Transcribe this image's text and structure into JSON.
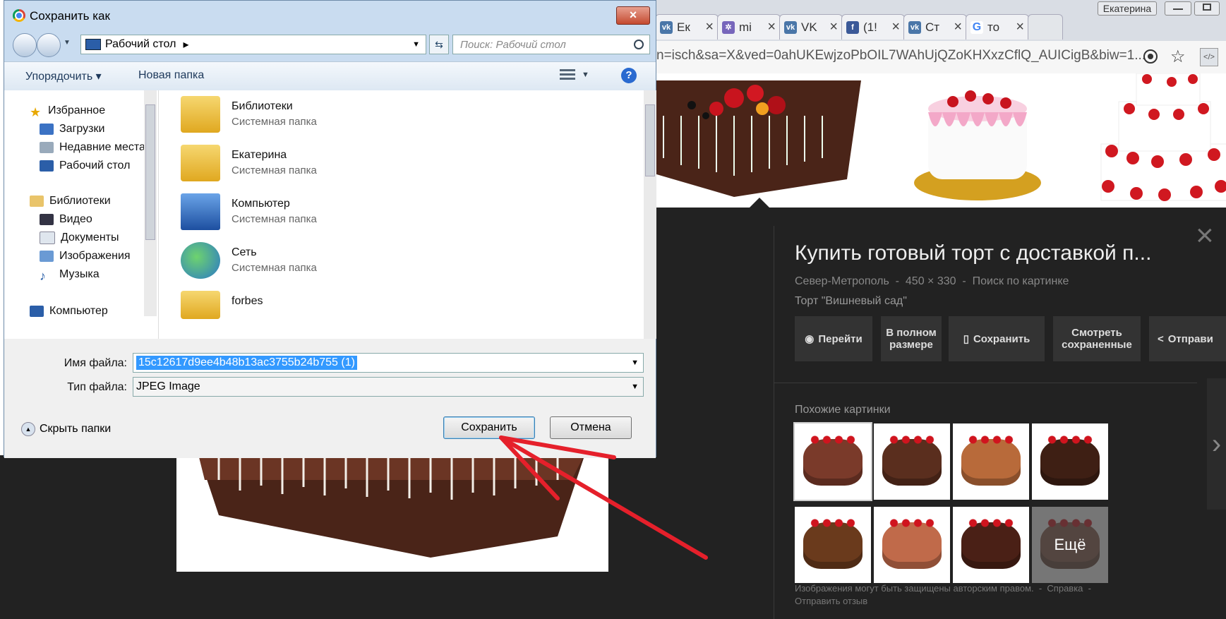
{
  "dialog": {
    "title": "Сохранить как",
    "close_glyph": "×",
    "path": "Рабочий стол",
    "path_arrow": "▸",
    "search_placeholder": "Поиск: Рабочий стол",
    "organize_label": "Упорядочить ▾",
    "new_folder_label": "Новая папка",
    "help_glyph": "?",
    "nav": {
      "favorites": "Избранное",
      "downloads": "Загрузки",
      "recent": "Недавние места",
      "desktop": "Рабочий стол",
      "libraries": "Библиотеки",
      "video": "Видео",
      "documents": "Документы",
      "images": "Изображения",
      "music": "Музыка",
      "computer": "Компьютер"
    },
    "files": [
      {
        "name": "Библиотеки",
        "sub": "Системная папка"
      },
      {
        "name": "Екатерина",
        "sub": "Системная папка"
      },
      {
        "name": "Компьютер",
        "sub": "Системная папка"
      },
      {
        "name": "Сеть",
        "sub": "Системная папка"
      },
      {
        "name": "forbes",
        "sub": ""
      }
    ],
    "filename_label": "Имя файла:",
    "filename_value": "15c12617d9ee4b48b13ac3755b24b755 (1)",
    "filetype_label": "Тип файла:",
    "filetype_value": "JPEG Image",
    "hide_folders": "Скрыть папки",
    "save_button": "Сохранить",
    "cancel_button": "Отмена"
  },
  "browser": {
    "user": "Екатерина",
    "tabs": [
      {
        "label": "Ек",
        "fav": "vk"
      },
      {
        "label": "mi",
        "fav": "mi"
      },
      {
        "label": "VK",
        "fav": "vk"
      },
      {
        "label": "(1!",
        "fav": "fb"
      },
      {
        "label": "Ст",
        "fav": "vk"
      },
      {
        "label": "то",
        "fav": "g"
      }
    ],
    "url": "n=isch&sa=X&ved=0ahUKEwjzoPbOIL7WAhUjQZoKHXxzCflQ_AUICigB&biw=1..."
  },
  "google": {
    "title": "Купить готовый торт с доставкой п...",
    "meta": "Север-Метрополь  -  450 × 330  -  Поиск по картинке",
    "caption": "Торт \"Вишневый сад\"",
    "buttons": {
      "visit": "Перейти",
      "fullsize": "В полном размере",
      "save": "Сохранить",
      "view_saved": "Смотреть сохраненные",
      "share": "Отправи"
    },
    "similar_label": "Похожие картинки",
    "more_label": "Ещё",
    "copyright": "Изображения могут быть защищены авторским правом.  -  Справка  -",
    "feedback": "Отправить отзыв"
  },
  "colors": {
    "accent_red": "#e5202b",
    "selection": "#3399ff",
    "dark_bg": "#222222"
  }
}
